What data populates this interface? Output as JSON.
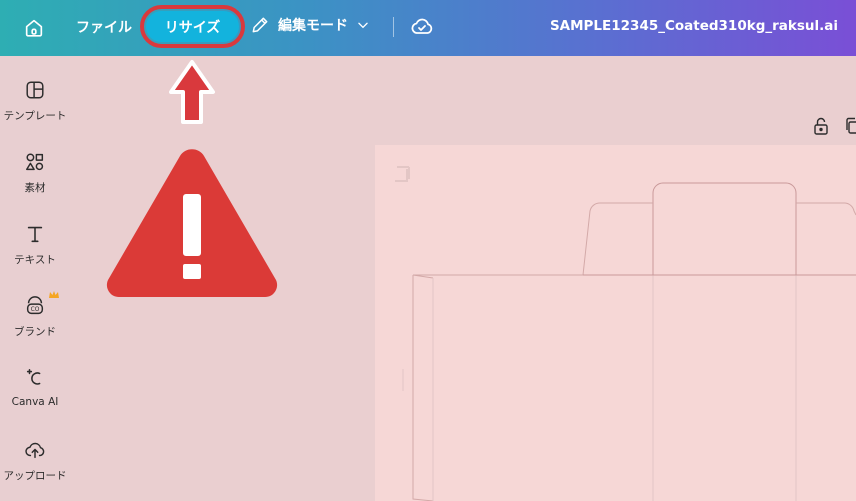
{
  "topbar": {
    "file_label": "ファイル",
    "resize_label": "リサイズ",
    "edit_mode_label": "編集モード",
    "filename": "SAMPLE12345_Coated310kg_raksul.ai"
  },
  "sidebar": {
    "items": [
      {
        "label": "テンプレート",
        "icon": "template-icon"
      },
      {
        "label": "素材",
        "icon": "elements-icon"
      },
      {
        "label": "テキスト",
        "icon": "text-icon"
      },
      {
        "label": "ブランド",
        "icon": "brand-icon"
      },
      {
        "label": "Canva AI",
        "icon": "canva-ai-icon"
      },
      {
        "label": "アップロード",
        "icon": "upload-icon"
      }
    ]
  },
  "colors": {
    "accent_resize": "#13b3dd",
    "highlight_red": "#d9393d",
    "canvas_bg": "#f6d7d6",
    "workspace_bg": "#eacfd0"
  }
}
